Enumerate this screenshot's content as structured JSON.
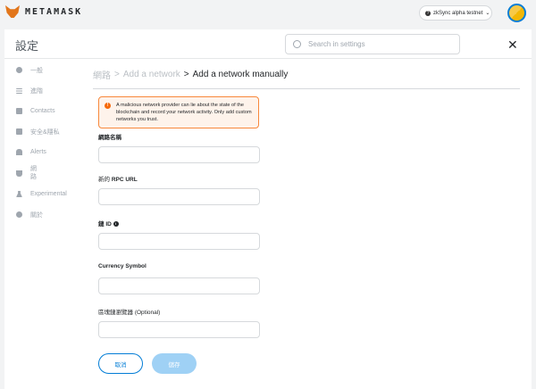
{
  "app": {
    "name": "METAMASK",
    "network": "zkSync alpha testnet"
  },
  "header": {
    "title": "設定",
    "search_placeholder": "Search in settings"
  },
  "sidebar": {
    "items": [
      {
        "label": "一般",
        "icon": "gear-icon"
      },
      {
        "label": "進階",
        "icon": "sliders-icon"
      },
      {
        "label": "Contacts",
        "icon": "contacts-icon"
      },
      {
        "label": "安全&隱私",
        "icon": "lock-icon"
      },
      {
        "label": "Alerts",
        "icon": "bell-icon"
      },
      {
        "label": "網\n路",
        "icon": "plug-icon"
      },
      {
        "label": "Experimental",
        "icon": "flask-icon"
      },
      {
        "label": "關於",
        "icon": "info-icon"
      }
    ]
  },
  "breadcrumb": {
    "root": "網路",
    "mid": "Add a network",
    "current": "Add a network manually",
    "sep": ">"
  },
  "warning": "A malicious network provider can lie about the state of the blockchain and record your network activity. Only add custom networks you trust.",
  "form": {
    "network_name": "網路名稱",
    "rpc_url_prefix": "新的",
    "rpc_url": "RPC URL",
    "chain_id_prefix": "鏈",
    "chain_id": "ID",
    "currency_symbol": "Currency Symbol",
    "explorer": "區塊鏈瀏覽器",
    "optional": "(Optional)"
  },
  "buttons": {
    "cancel": "取消",
    "save": "儲存"
  },
  "colors": {
    "accent": "#037dd6",
    "warning": "#f8883b"
  }
}
